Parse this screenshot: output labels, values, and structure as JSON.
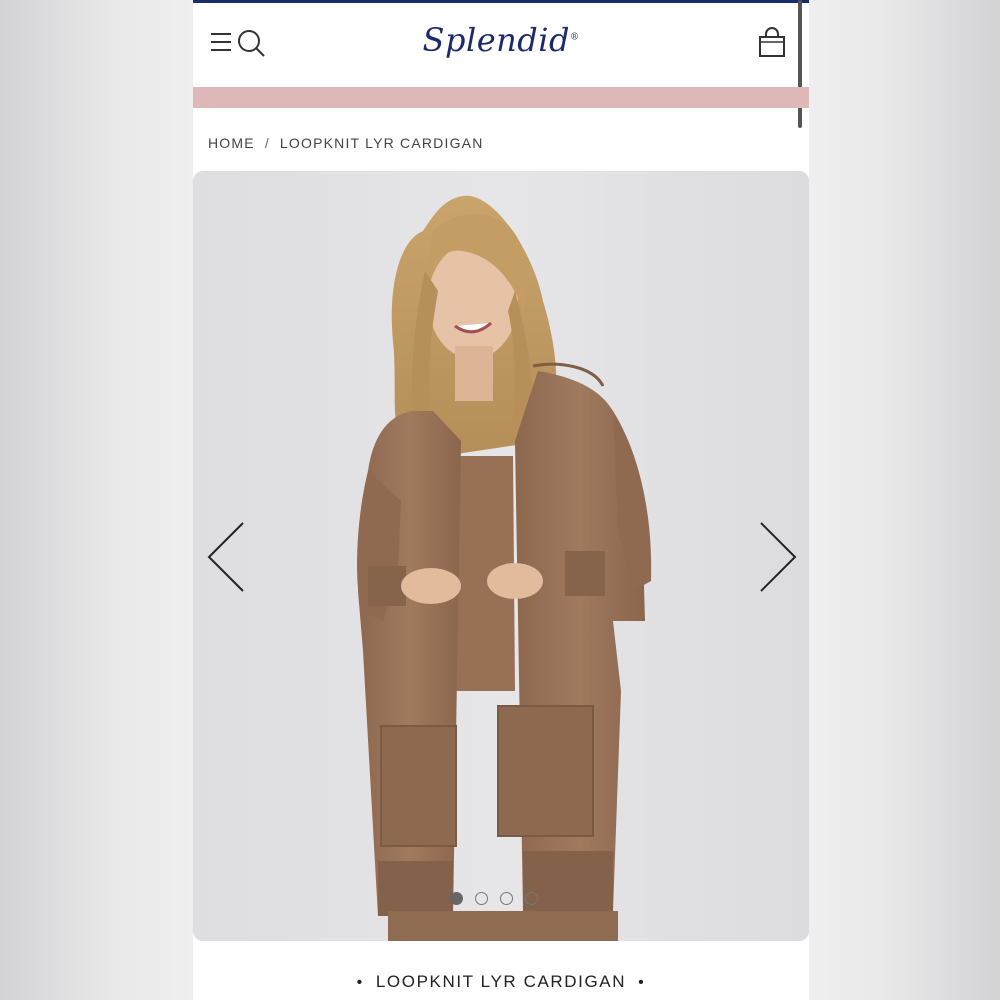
{
  "brand": {
    "logo_text": "Splendid",
    "registered_mark": "®",
    "navy": "#1b2a6b"
  },
  "header": {
    "menu_icon": "hamburger-menu-icon",
    "search_icon": "search-icon",
    "bag_icon": "shopping-bag-icon"
  },
  "promo_bar": {
    "color": "#dfb9b9",
    "text": ""
  },
  "breadcrumb": {
    "home": "HOME",
    "separator": "/",
    "current": "LOOPKNIT LYR CARDIGAN"
  },
  "gallery": {
    "prev_icon": "chevron-left-icon",
    "next_icon": "chevron-right-icon",
    "image_count": 4,
    "active_index": 0,
    "garment_color": "#9a7358"
  },
  "product": {
    "title": "LOOPKNIT LYR CARDIGAN",
    "bullet": "•"
  }
}
